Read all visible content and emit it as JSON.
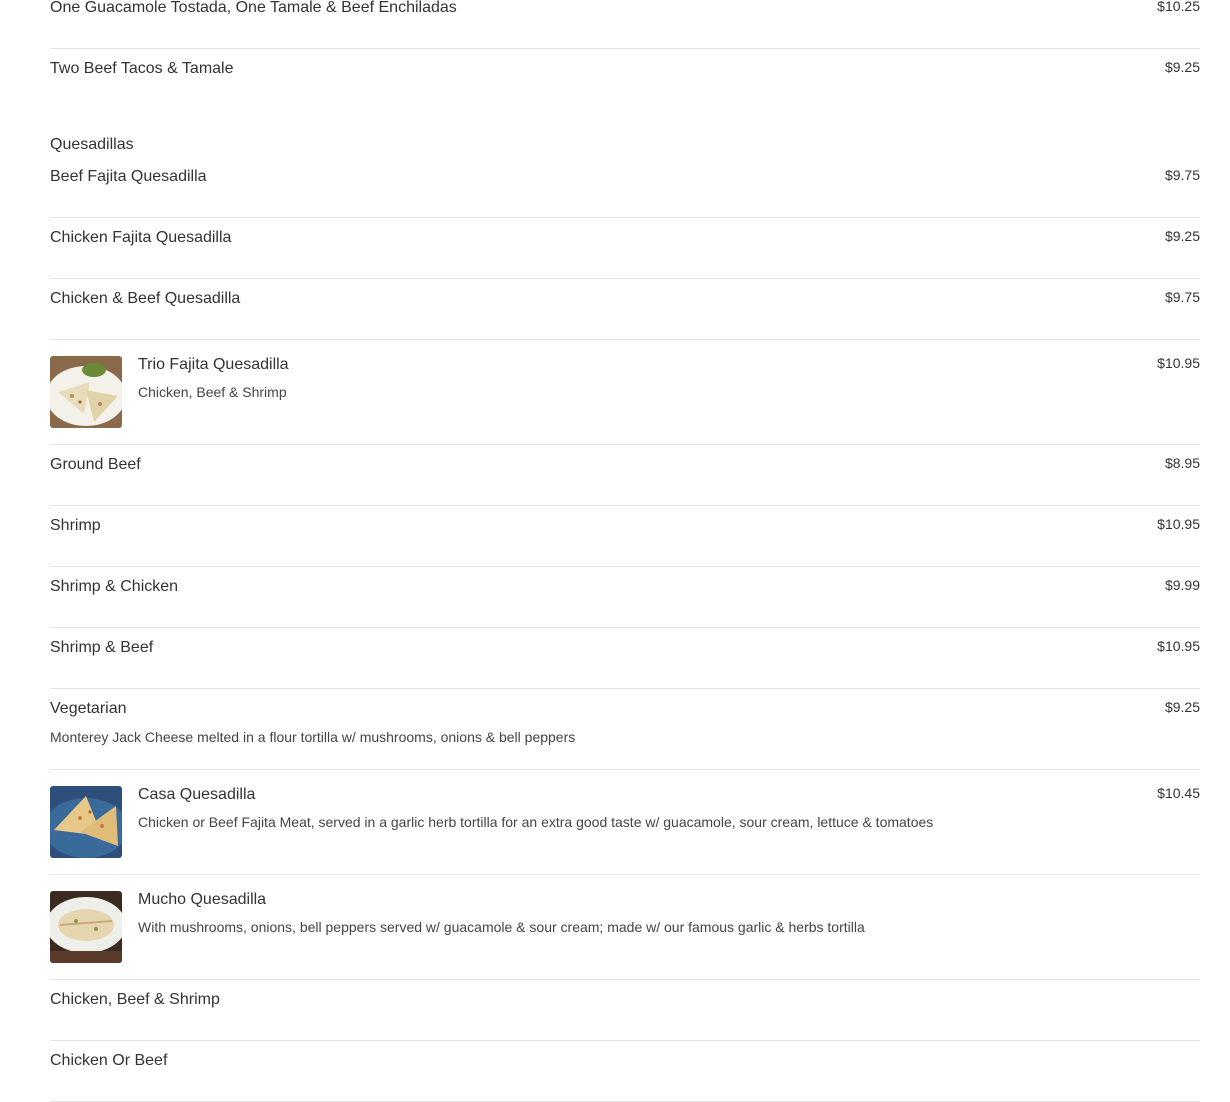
{
  "previous_section": {
    "items": [
      {
        "name": "One Guacamole Tostada, One Tamale & Beef Enchiladas",
        "price": "$10.25"
      },
      {
        "name": "Two Beef Tacos & Tamale",
        "price": "$9.25"
      }
    ]
  },
  "quesadillas": {
    "heading": "Quesadillas",
    "items": [
      {
        "name": "Beef Fajita Quesadilla",
        "price": "$9.75"
      },
      {
        "name": "Chicken Fajita Quesadilla",
        "price": "$9.25"
      },
      {
        "name": "Chicken & Beef Quesadilla",
        "price": "$9.75"
      },
      {
        "name": "Trio Fajita Quesadilla",
        "description": "Chicken, Beef & Shrimp",
        "price": "$10.95"
      },
      {
        "name": "Ground Beef",
        "price": "$8.95"
      },
      {
        "name": "Shrimp",
        "price": "$10.95"
      },
      {
        "name": "Shrimp & Chicken",
        "price": "$9.99"
      },
      {
        "name": "Shrimp & Beef",
        "price": "$10.95"
      },
      {
        "name": "Vegetarian",
        "description": "Monterey Jack Cheese melted in a flour tortilla w/ mushrooms, onions & bell peppers",
        "price": "$9.25"
      },
      {
        "name": "Casa Quesadilla",
        "description": "Chicken or Beef Fajita Meat, served in a garlic herb tortilla for an extra good taste w/ guacamole, sour cream, lettuce & tomatoes",
        "price": "$10.45"
      },
      {
        "name": "Mucho Quesadilla",
        "description": "With mushrooms, onions, bell peppers served w/ guacamole & sour cream; made w/ our famous garlic & herbs tortilla",
        "price": ""
      },
      {
        "name": "Chicken, Beef & Shrimp",
        "price": ""
      },
      {
        "name": "Chicken Or Beef",
        "price": ""
      }
    ]
  },
  "colors": {
    "text": "#333333",
    "divider": "#e6e6e6",
    "background": "#ffffff"
  }
}
